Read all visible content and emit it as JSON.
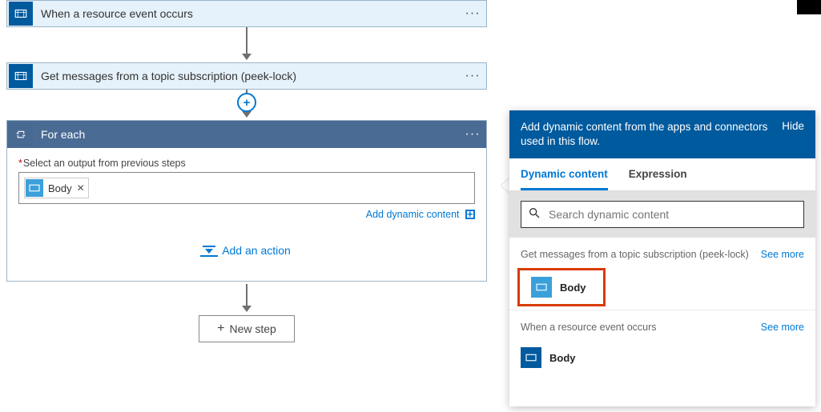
{
  "steps": {
    "trigger": {
      "label": "When a resource event occurs"
    },
    "getmsgs": {
      "label": "Get messages from a topic subscription (peek-lock)"
    }
  },
  "foreach": {
    "title": "For each",
    "field_label": "Select an output from previous steps",
    "token_label": "Body",
    "dyn_link": "Add dynamic content",
    "add_action": "Add an action"
  },
  "newstep": {
    "label": "New step"
  },
  "panel": {
    "lead": "Add dynamic content from the apps and connectors used in this flow.",
    "hide": "Hide",
    "tabs": {
      "dynamic": "Dynamic content",
      "expression": "Expression"
    },
    "search_placeholder": "Search dynamic content",
    "sections": [
      {
        "title": "Get messages from a topic subscription (peek-lock)",
        "see_more": "See more",
        "item": "Body",
        "icon": "servicebus-light",
        "highlight": true
      },
      {
        "title": "When a resource event occurs",
        "see_more": "See more",
        "item": "Body",
        "icon": "servicebus-dark",
        "highlight": false
      }
    ]
  }
}
